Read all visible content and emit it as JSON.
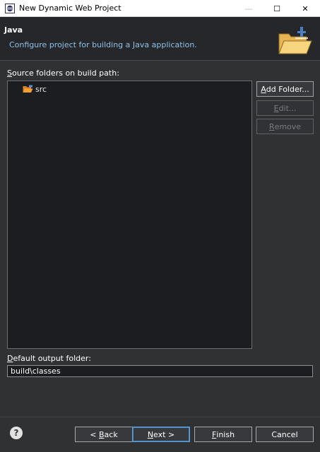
{
  "window": {
    "title": "New Dynamic Web Project",
    "minimize_glyph": "—",
    "maximize_glyph": "☐",
    "close_glyph": "✕"
  },
  "banner": {
    "title": "Java",
    "description": "Configure project for building a Java application.",
    "icon": "java-folder-icon"
  },
  "source_section": {
    "label_mnemonic": "S",
    "label_rest": "ource folders on build path:",
    "items": [
      {
        "label": "src",
        "icon": "source-folder-icon"
      }
    ]
  },
  "buttons": {
    "add_folder_mnemonic": "A",
    "add_folder_rest": "dd Folder...",
    "edit_mnemonic": "E",
    "edit_rest": "dit...",
    "remove_mnemonic": "R",
    "remove_rest": "emove"
  },
  "output_section": {
    "label_mnemonic": "D",
    "label_rest": "efault output folder:",
    "value": "build\\classes"
  },
  "footer": {
    "help_icon": "help-icon",
    "help_glyph": "?",
    "back_prefix": "< ",
    "back_mnemonic": "B",
    "back_rest": "ack",
    "next_mnemonic": "N",
    "next_rest": "ext >",
    "finish_mnemonic": "F",
    "finish_rest": "inish",
    "cancel_label": "Cancel"
  },
  "colors": {
    "background": "#2f3133",
    "banner": "#25272a",
    "tree_background": "#1b1d20",
    "description_text": "#8fc1e8",
    "folder_orange": "#f0a030",
    "default_button_border": "#5a9fe0"
  }
}
